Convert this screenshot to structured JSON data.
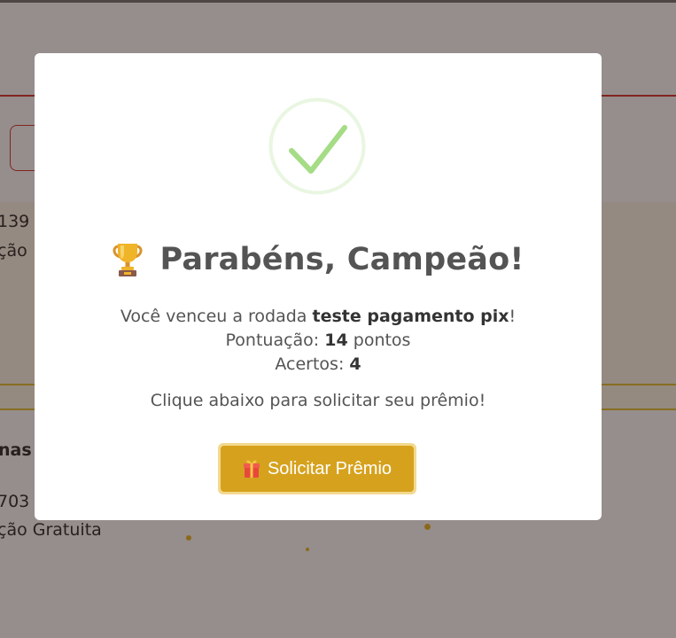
{
  "background": {
    "row1_value": "139",
    "row1_label": "ção",
    "row2_title": "nas",
    "row2_value": "703",
    "row2_label": "ção Gratuita"
  },
  "modal": {
    "title": "Parabéns, Campeão!",
    "trophy_icon": "trophy-icon",
    "success_icon": "check-circle-icon",
    "round_prefix": "Você venceu a rodada ",
    "round_name": "teste pagamento pix",
    "round_suffix": "!",
    "score_prefix": "Pontuação: ",
    "score_value": "14",
    "score_suffix": " pontos",
    "hits_prefix": "Acertos: ",
    "hits_value": "4",
    "cta_text": "Clique abaixo para solicitar seu prêmio!",
    "button_label": "Solicitar Prêmio",
    "button_icon": "gift-icon"
  },
  "colors": {
    "accent": "#d6a21e",
    "success": "#a5dc86",
    "title_text": "#545454"
  }
}
